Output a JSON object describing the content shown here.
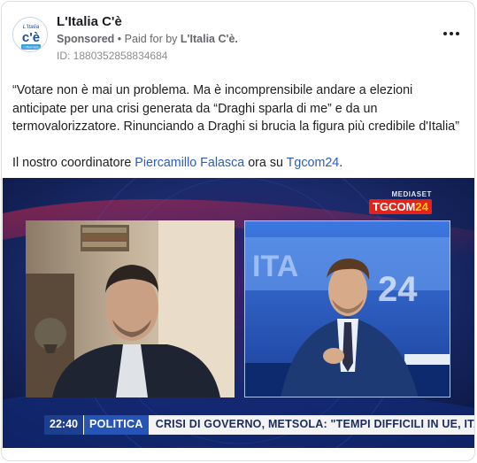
{
  "post": {
    "page_name": "L'Italia C'è",
    "sponsored_label": "Sponsored",
    "separator": "•",
    "paid_for_prefix": "Paid for by",
    "paid_for_name": "L'Italia C'è.",
    "ad_id": "ID: 1880352858834684",
    "avatar_logo": {
      "line1": "L'Italia",
      "line2": "c'è",
      "line3": "i riformisti"
    },
    "more_icon": "more-horizontal-icon"
  },
  "body": {
    "line1": "“Votare non è mai un problema. Ma è incomprensibile andare a elezioni anticipate per una crisi generata da “Draghi sparla di me” e da un termovalorizzatore. Rinunciando a Draghi si brucia la figura più credibile d'Italia”",
    "line2_prefix": "Il nostro coordinatore ",
    "line2_link1": "Piercamillo Falasca",
    "line2_middle": " ora su ",
    "line2_link2": "Tgcom24",
    "line2_suffix": "."
  },
  "media": {
    "broadcaster_small": "MEDIASET",
    "broadcaster_logo_a": "TGCOM",
    "broadcaster_logo_b": "24",
    "ticker_time": "22:40",
    "ticker_section": "POLITICA",
    "ticker_headline": "CRISI DI GOVERNO, METSOLA: \"TEMPI DIFFICILI IN UE, ITALIA MANTENGA LEADERSHIP\""
  },
  "colors": {
    "link": "#2d5bb9",
    "ticker_time_bg": "#1d3f8f",
    "ticker_section_bg": "#2755b5",
    "tgcom_red": "#e2231a"
  }
}
